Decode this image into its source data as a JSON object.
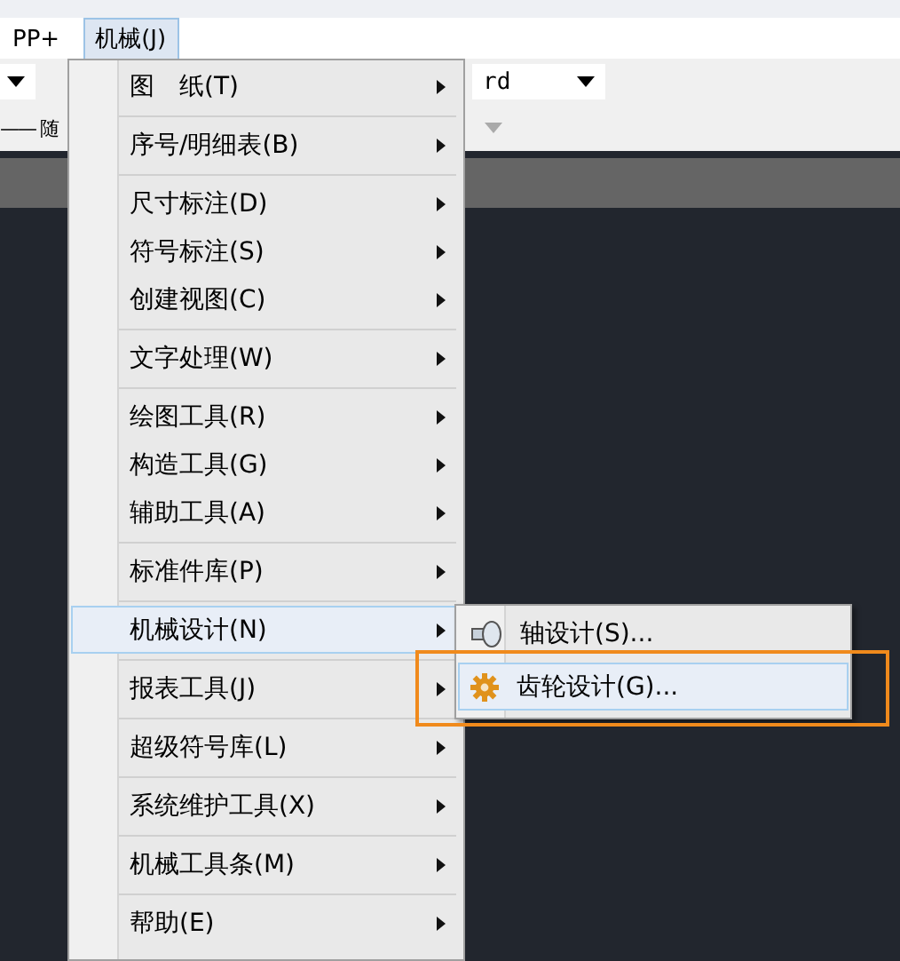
{
  "menubar": {
    "items": [
      {
        "label": "PP+",
        "selected": false
      },
      {
        "label": "机械(J)",
        "selected": true
      }
    ]
  },
  "toolbar": {
    "row_1_field": "rd",
    "row_2_field": "—— 随"
  },
  "menu": {
    "groups": [
      [
        {
          "label": "图　纸(T)",
          "submenu": true,
          "selected": false
        }
      ],
      [
        {
          "label": "序号/明细表(B)",
          "submenu": true,
          "selected": false
        }
      ],
      [
        {
          "label": "尺寸标注(D)",
          "submenu": true,
          "selected": false
        },
        {
          "label": "符号标注(S)",
          "submenu": true,
          "selected": false
        },
        {
          "label": "创建视图(C)",
          "submenu": true,
          "selected": false
        }
      ],
      [
        {
          "label": "文字处理(W)",
          "submenu": true,
          "selected": false
        }
      ],
      [
        {
          "label": "绘图工具(R)",
          "submenu": true,
          "selected": false
        },
        {
          "label": "构造工具(G)",
          "submenu": true,
          "selected": false
        },
        {
          "label": "辅助工具(A)",
          "submenu": true,
          "selected": false
        }
      ],
      [
        {
          "label": "标准件库(P)",
          "submenu": true,
          "selected": false
        }
      ],
      [
        {
          "label": "机械设计(N)",
          "submenu": true,
          "selected": true
        }
      ],
      [
        {
          "label": "报表工具(J)",
          "submenu": true,
          "selected": false
        }
      ],
      [
        {
          "label": "超级符号库(L)",
          "submenu": true,
          "selected": false
        }
      ],
      [
        {
          "label": "系统维护工具(X)",
          "submenu": true,
          "selected": false
        }
      ],
      [
        {
          "label": "机械工具条(M)",
          "submenu": true,
          "selected": false
        }
      ],
      [
        {
          "label": "帮助(E)",
          "submenu": true,
          "selected": false
        }
      ]
    ]
  },
  "submenu": {
    "items": [
      {
        "label": "轴设计(S)...",
        "kind": "shaft",
        "selected": false,
        "annotated": false
      },
      {
        "label": "齿轮设计(G)...",
        "kind": "gear",
        "selected": true,
        "annotated": true
      }
    ]
  }
}
